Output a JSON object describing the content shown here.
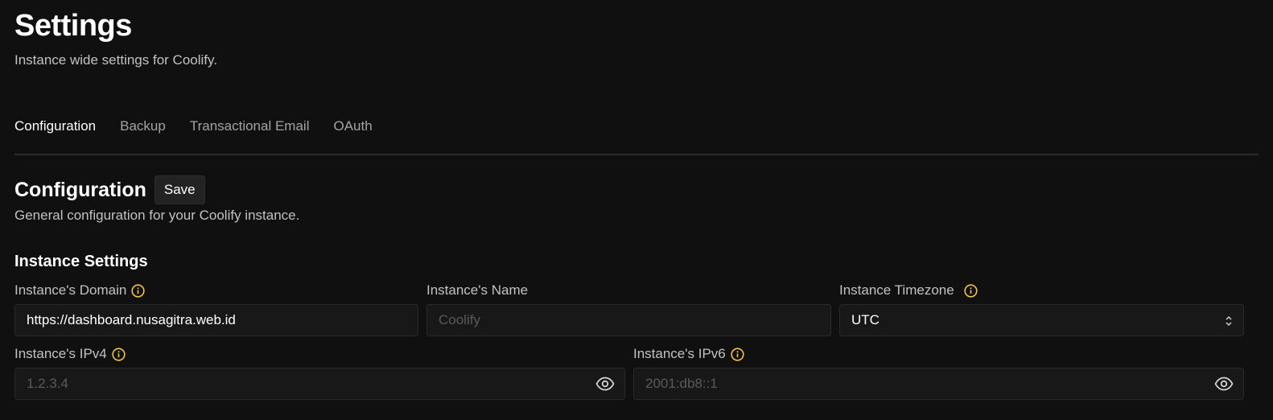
{
  "header": {
    "title": "Settings",
    "subtitle": "Instance wide settings for Coolify."
  },
  "tabs": [
    {
      "label": "Configuration",
      "active": true
    },
    {
      "label": "Backup",
      "active": false
    },
    {
      "label": "Transactional Email",
      "active": false
    },
    {
      "label": "OAuth",
      "active": false
    }
  ],
  "section": {
    "title": "Configuration",
    "save_label": "Save",
    "subtitle": "General configuration for your Coolify instance."
  },
  "instance_settings": {
    "title": "Instance Settings",
    "domain": {
      "label": "Instance's Domain",
      "value": "https://dashboard.nusagitra.web.id",
      "placeholder": ""
    },
    "name": {
      "label": "Instance's Name",
      "value": "",
      "placeholder": "Coolify"
    },
    "timezone": {
      "label": "Instance Timezone",
      "value": "UTC"
    },
    "ipv4": {
      "label": "Instance's IPv4",
      "value": "",
      "placeholder": "1.2.3.4"
    },
    "ipv6": {
      "label": "Instance's IPv6",
      "value": "",
      "placeholder": "2001:db8::1"
    }
  },
  "colors": {
    "background": "#101010",
    "input_background": "#181818",
    "info_icon": "#f5c542",
    "muted_text": "#c2c2c2"
  },
  "icons": {
    "info": "info-icon",
    "eye": "eye-icon",
    "select": "chevron-updown-icon"
  }
}
